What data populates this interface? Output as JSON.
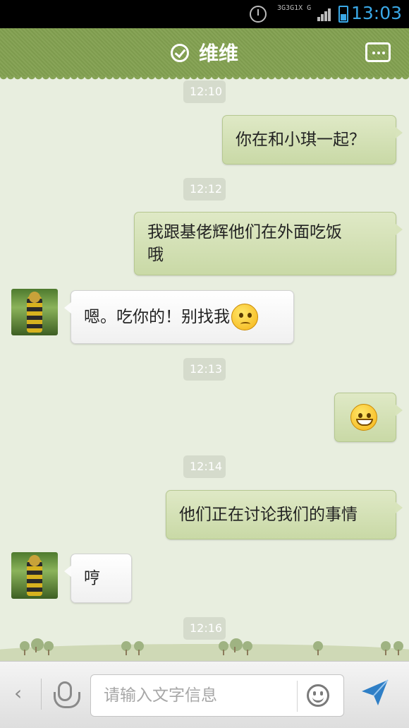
{
  "status_bar": {
    "network_labels": [
      "3G",
      "3G",
      "1X",
      "G"
    ],
    "time": "13:03",
    "icons": [
      "alarm-icon",
      "signal-icon",
      "battery-icon"
    ],
    "accent_color": "#3aa8e6"
  },
  "header": {
    "title": "维维",
    "status_icon": "check-circle-icon",
    "menu_icon": "more-icon",
    "bar_color": "#84a154"
  },
  "messages": [
    {
      "type": "time",
      "text": "12:10"
    },
    {
      "type": "out",
      "text": "你在和小琪一起？"
    },
    {
      "type": "time",
      "text": "12:12"
    },
    {
      "type": "out",
      "text": "我跟基佬辉他们在外面吃饭",
      "text2": "哦"
    },
    {
      "type": "in",
      "text": "嗯。吃你的！别找我",
      "emoji": "confused-face-icon"
    },
    {
      "type": "time",
      "text": "12:13"
    },
    {
      "type": "out",
      "emoji": "grin-face-icon"
    },
    {
      "type": "time",
      "text": "12:14"
    },
    {
      "type": "out",
      "text": "他们正在讨论我们的事情"
    },
    {
      "type": "in",
      "text": "哼"
    },
    {
      "type": "time",
      "text": "12:16"
    }
  ],
  "input_bar": {
    "back_label": "‹",
    "placeholder": "请输入文字信息",
    "icons": [
      "back-icon",
      "mic-icon",
      "emoji-icon",
      "send-icon"
    ]
  }
}
